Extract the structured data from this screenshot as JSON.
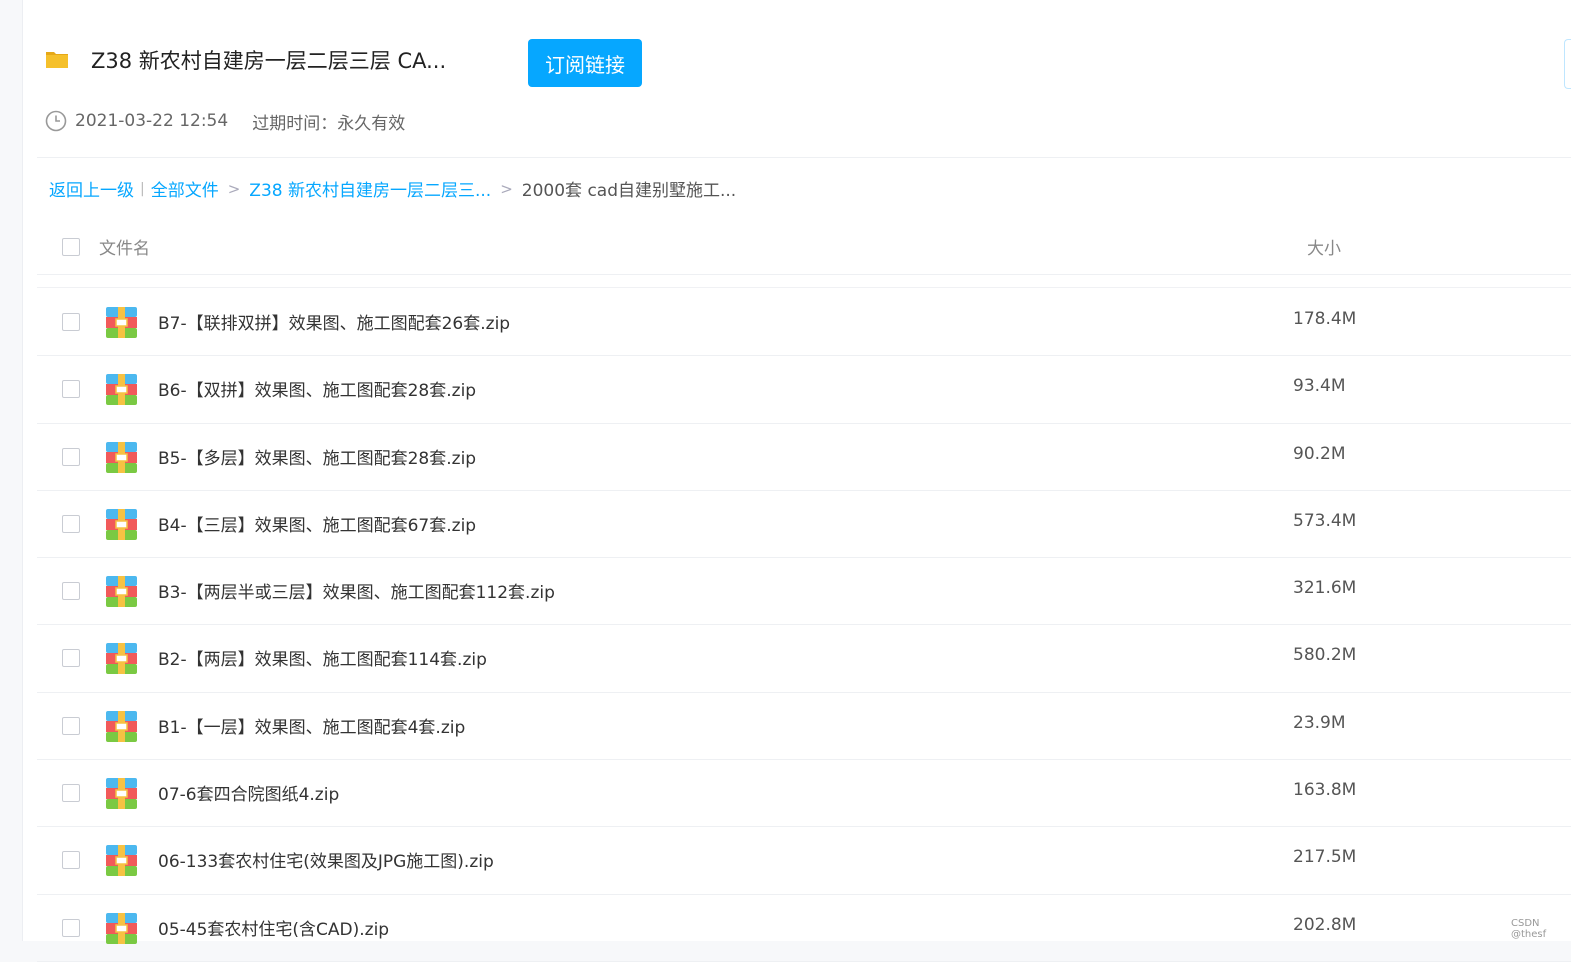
{
  "share": {
    "title": "Z38 新农村自建房一层二层三层 CA...",
    "subscribe_label": "订阅链接",
    "date": "2021-03-22 12:54",
    "expire": "过期时间：永久有效"
  },
  "breadcrumb": {
    "back": "返回上一级",
    "sep": "|",
    "all_files": "全部文件",
    "arrow": ">",
    "level1": "Z38 新农村自建房一层二层三...",
    "current": "2000套 cad自建别墅施工..."
  },
  "table": {
    "col_name": "文件名",
    "col_size": "大小"
  },
  "files": [
    {
      "name": "B7-【联排双拼】效果图、施工图配套26套.zip",
      "size": "178.4M"
    },
    {
      "name": "B6-【双拼】效果图、施工图配套28套.zip",
      "size": "93.4M"
    },
    {
      "name": "B5-【多层】效果图、施工图配套28套.zip",
      "size": "90.2M"
    },
    {
      "name": "B4-【三层】效果图、施工图配套67套.zip",
      "size": "573.4M"
    },
    {
      "name": "B3-【两层半或三层】效果图、施工图配套112套.zip",
      "size": "321.6M"
    },
    {
      "name": "B2-【两层】效果图、施工图配套114套.zip",
      "size": "580.2M"
    },
    {
      "name": "B1-【一层】效果图、施工图配套4套.zip",
      "size": "23.9M"
    },
    {
      "name": "07-6套四合院图纸4.zip",
      "size": "163.8M"
    },
    {
      "name": "06-133套农村住宅(效果图及JPG施工图).zip",
      "size": "217.5M"
    },
    {
      "name": "05-45套农村住宅(含CAD).zip",
      "size": "202.8M"
    }
  ],
  "watermark": "CSDN @thesf",
  "colors": {
    "accent": "#06a7ff",
    "folder": "#f5c02b"
  },
  "icons": {
    "folder": "folder-icon",
    "clock": "clock-icon",
    "file": "zip-archive-icon",
    "checkbox": "checkbox"
  }
}
